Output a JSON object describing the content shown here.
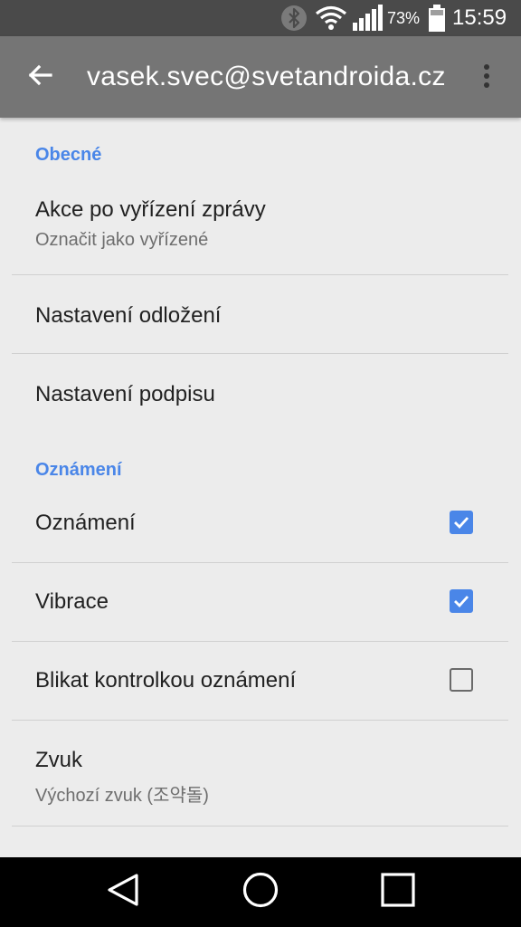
{
  "status_bar": {
    "battery_percent": "73%",
    "time": "15:59",
    "icons": [
      "bluetooth-icon",
      "wifi-icon",
      "signal-icon",
      "battery-icon"
    ]
  },
  "app_bar": {
    "title": "vasek.svec@svetandroida.cz",
    "icons": [
      "back-arrow-icon",
      "more-vert-icon"
    ]
  },
  "sections": {
    "general": {
      "header": "Obecné",
      "items": [
        {
          "title": "Akce po vyřízení zprávy",
          "subtitle": "Označit jako vyřízené"
        },
        {
          "title": "Nastavení odložení"
        },
        {
          "title": "Nastavení podpisu"
        }
      ]
    },
    "notifications": {
      "header": "Oznámení",
      "items": [
        {
          "title": "Oznámení",
          "checked": true
        },
        {
          "title": "Vibrace",
          "checked": true
        },
        {
          "title": "Blikat kontrolkou oznámení",
          "checked": false
        },
        {
          "title": "Zvuk",
          "subtitle": "Výchozí zvuk (조약돌)"
        }
      ]
    }
  },
  "nav_bar": {
    "icons": [
      "nav-back-icon",
      "nav-home-icon",
      "nav-recents-icon"
    ]
  },
  "colors": {
    "accent": "#4a86e8",
    "app_bar": "#757575",
    "status_bar": "#4a4a4a",
    "background": "#ececec"
  }
}
